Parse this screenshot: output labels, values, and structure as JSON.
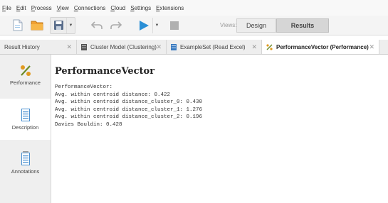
{
  "menu": [
    {
      "accel": "F",
      "rest": "ile"
    },
    {
      "accel": "E",
      "rest": "dit"
    },
    {
      "accel": "P",
      "rest": "rocess"
    },
    {
      "accel": "V",
      "rest": "iew"
    },
    {
      "accel": "C",
      "rest": "onnections"
    },
    {
      "accel": "C",
      "rest": "loud"
    },
    {
      "accel": "S",
      "rest": "ettings"
    },
    {
      "accel": "E",
      "rest": "xtensions"
    }
  ],
  "toolbar": {
    "icons": [
      "new-process-icon",
      "open-folder-icon",
      "save-icon",
      "undo-icon",
      "redo-icon",
      "run-icon",
      "stop-icon"
    ],
    "views_label": "Views:",
    "design_label": "Design",
    "results_label": "Results",
    "active_view": "Results"
  },
  "tabs": [
    {
      "label": "Result History",
      "icon": "none",
      "active": false
    },
    {
      "label": "Cluster Model (Clustering)",
      "icon": "cluster-model-icon",
      "active": false
    },
    {
      "label": "ExampleSet (Read Excel)",
      "icon": "example-set-icon",
      "active": false
    },
    {
      "label": "PerformanceVector (Performance)",
      "icon": "percent-icon",
      "active": true
    }
  ],
  "sidebar": [
    {
      "label": "Performance",
      "icon": "percent-icon",
      "active": false
    },
    {
      "label": "Description",
      "icon": "document-icon",
      "active": true
    },
    {
      "label": "Annotations",
      "icon": "notes-icon",
      "active": false
    }
  ],
  "content": {
    "title": "PerformanceVector",
    "lines": [
      "PerformanceVector:",
      "Avg. within centroid distance: 0.422",
      "Avg. within centroid distance_cluster_0: 0.430",
      "Avg. within centroid distance_cluster_1: 1.276",
      "Avg. within centroid distance_cluster_2: 0.196",
      "Davies Bouldin: 0.428"
    ]
  }
}
